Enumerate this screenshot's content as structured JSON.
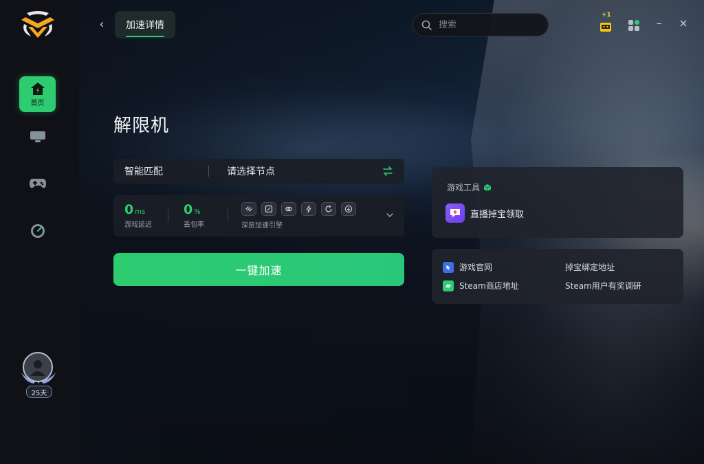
{
  "header": {
    "back_label": "‹",
    "detail_tab": "加速详情",
    "search_placeholder": "搜索",
    "badge": "+1",
    "minimize": "–",
    "close": "×"
  },
  "sidebar": {
    "items": [
      {
        "name": "home",
        "label": "首页",
        "active": true
      },
      {
        "name": "host",
        "label": "",
        "active": false
      },
      {
        "name": "game",
        "label": "",
        "active": false
      },
      {
        "name": "speed",
        "label": "",
        "active": false
      }
    ],
    "membership_days": "25天"
  },
  "main": {
    "game_title": "解限机",
    "smart_match": "智能匹配",
    "node_placeholder": "请选择节点",
    "latency_value": "0",
    "latency_unit": "ms",
    "latency_label": "游戏延迟",
    "loss_value": "0",
    "loss_unit": "%",
    "loss_label": "丢包率",
    "engine_label": "深层加速引擎",
    "accelerate_button": "一键加速"
  },
  "tools": {
    "title": "游戏工具",
    "item_label": "直播掉宝领取"
  },
  "links": {
    "official_site": "游戏官网",
    "steam_store": "Steam商店地址",
    "drop_binding": "掉宝绑定地址",
    "steam_survey": "Steam用户有奖调研"
  },
  "colors": {
    "accent": "#2ecc71",
    "panel": "#20232c",
    "tool_icon": "#7c4dff"
  }
}
